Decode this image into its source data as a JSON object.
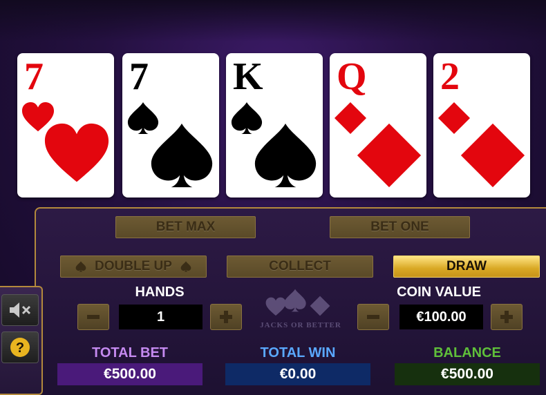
{
  "cards": [
    {
      "rank": "7",
      "suit": "hearts",
      "color": "#e3060e"
    },
    {
      "rank": "7",
      "suit": "spades",
      "color": "#000000"
    },
    {
      "rank": "K",
      "suit": "spades",
      "color": "#000000"
    },
    {
      "rank": "Q",
      "suit": "diamonds",
      "color": "#e3060e"
    },
    {
      "rank": "2",
      "suit": "diamonds",
      "color": "#e3060e"
    }
  ],
  "buttons": {
    "bet_max": "BET MAX",
    "bet_one": "BET ONE",
    "double_up": "DOUBLE UP",
    "collect": "COLLECT",
    "draw": "DRAW"
  },
  "hands": {
    "label": "HANDS",
    "value": "1"
  },
  "coin_value": {
    "label": "COIN VALUE",
    "value": "€100.00"
  },
  "totals": {
    "total_bet": {
      "label": "TOTAL BET",
      "value": "€500.00",
      "label_color": "#c58af0",
      "box_color": "#4a1a7a"
    },
    "total_win": {
      "label": "TOTAL WIN",
      "value": "€0.00",
      "label_color": "#5aa8ff",
      "box_color": "#0e2a66"
    },
    "balance": {
      "label": "BALANCE",
      "value": "€500.00",
      "label_color": "#5fbf3a",
      "box_color": "#16300e"
    }
  },
  "logo_text": "JACKS OR BETTER",
  "side": {
    "mute_icon": "mute-speaker-icon",
    "help_icon": "help-question-icon"
  },
  "colors": {
    "gold": "#b48a3c",
    "draw_button": "#e8bd3c"
  }
}
